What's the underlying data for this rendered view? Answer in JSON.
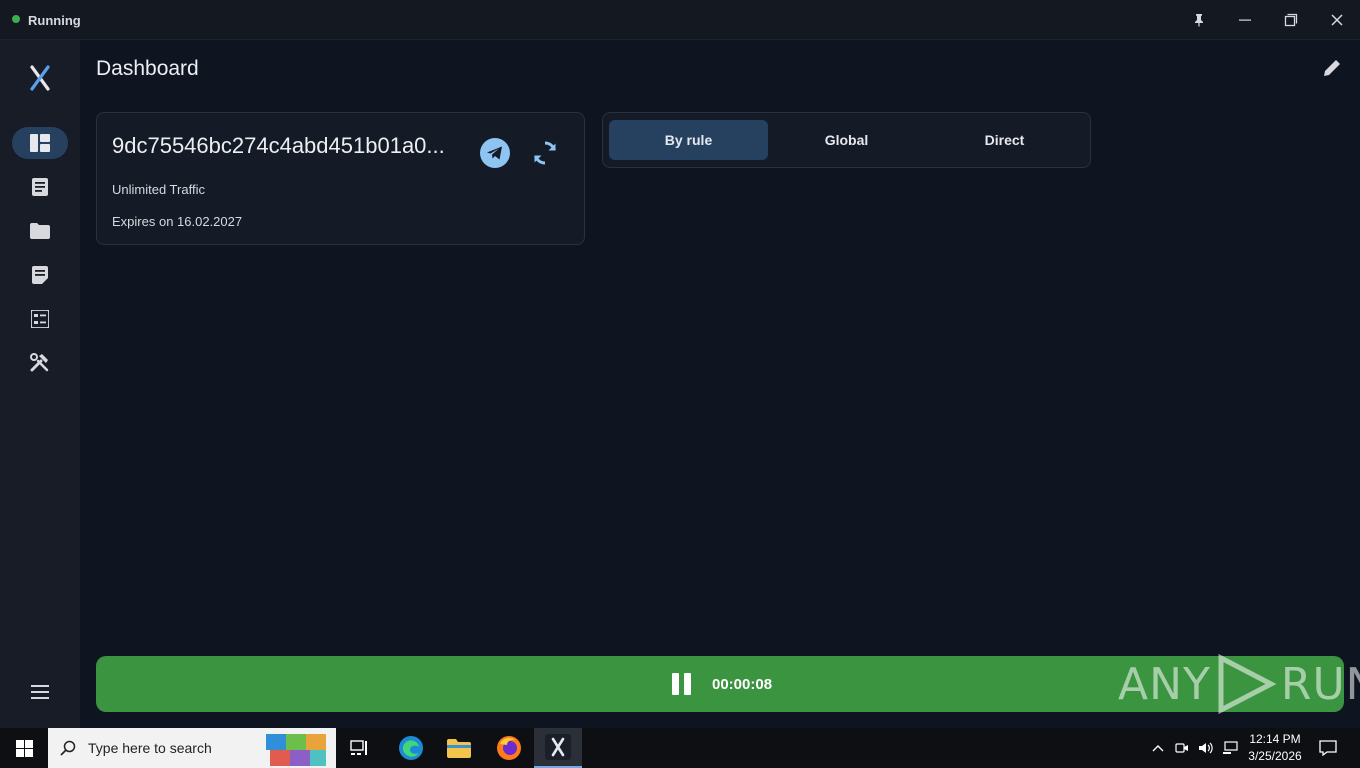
{
  "titlebar": {
    "status": "Running",
    "status_color": "#3fae4f"
  },
  "sidebar": {
    "logo": "x-logo-icon",
    "items": [
      {
        "icon": "dashboard-icon",
        "active": true
      },
      {
        "icon": "document-icon",
        "active": false
      },
      {
        "icon": "folder-icon",
        "active": false
      },
      {
        "icon": "notes-icon",
        "active": false
      },
      {
        "icon": "checklist-icon",
        "active": false
      },
      {
        "icon": "tools-icon",
        "active": false
      }
    ],
    "menu_icon": "hamburger-icon"
  },
  "main": {
    "title": "Dashboard",
    "profile": {
      "name": "9dc75546bc274c4abd451b01a0...",
      "traffic": "Unlimited Traffic",
      "expiry": "Expires on 16.02.2027"
    },
    "modes": [
      {
        "label": "By rule",
        "active": true
      },
      {
        "label": "Global",
        "active": false
      },
      {
        "label": "Direct",
        "active": false
      }
    ],
    "connection": {
      "timer": "00:00:08",
      "watermark": "ANY RUN"
    }
  },
  "taskbar": {
    "search_placeholder": "Type here to search",
    "time": "12:14 PM",
    "date": "3/25/2026"
  },
  "colors": {
    "accent": "#26415f",
    "connect_bar": "#3a9440",
    "background": "#0f1421"
  }
}
